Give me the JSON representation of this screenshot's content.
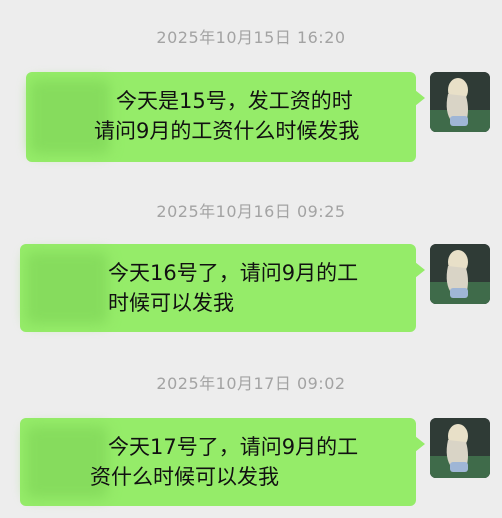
{
  "messages": [
    {
      "timestamp": "2025年10月15日 16:20",
      "line1": "今天是15号，发工资的时",
      "line2": "请问9月的工资什么时候发我",
      "avatar_icon": "user-avatar-icon"
    },
    {
      "timestamp": "2025年10月16日 09:25",
      "line1": "今天16号了，请问9月的工",
      "line2": "时候可以发我",
      "avatar_icon": "user-avatar-icon"
    },
    {
      "timestamp": "2025年10月17日 09:02",
      "line1": "今天17号了，请问9月的工",
      "line2": "资什么时候可以发我",
      "avatar_icon": "user-avatar-icon"
    }
  ],
  "colors": {
    "bubble": "#95ec69",
    "background": "#ededed",
    "timestamp": "#a3a3a3"
  }
}
